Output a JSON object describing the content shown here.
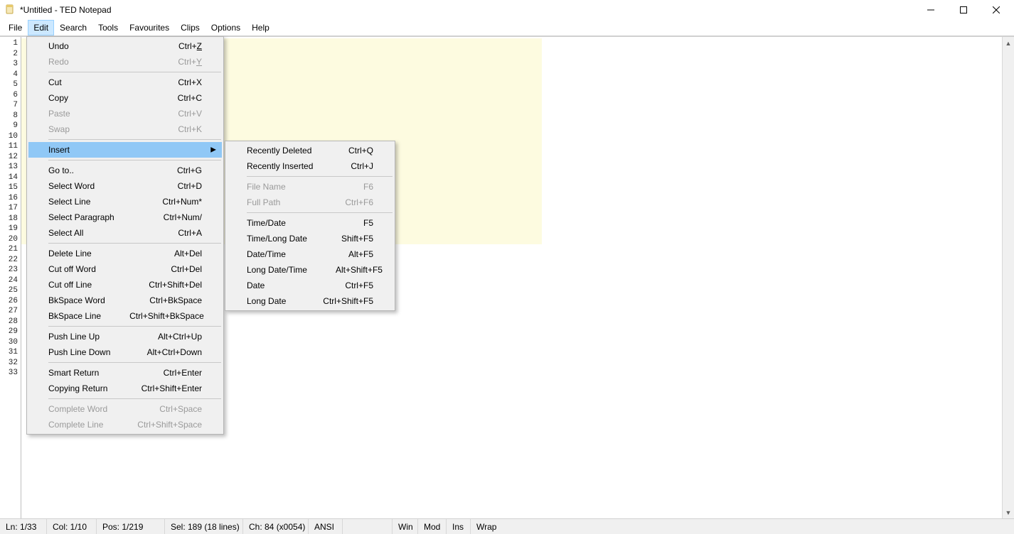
{
  "window": {
    "title": "*Untitled - TED Notepad"
  },
  "menubar": [
    "File",
    "Edit",
    "Search",
    "Tools",
    "Favourites",
    "Clips",
    "Options",
    "Help"
  ],
  "gutter_lines": 33,
  "edit_menu": {
    "groups": [
      [
        {
          "label": "Undo",
          "shortcut_prefix": "Ctrl+",
          "shortcut_ul": "Z",
          "disabled": false
        },
        {
          "label": "Redo",
          "shortcut_prefix": "Ctrl+",
          "shortcut_ul": "Y",
          "disabled": true
        }
      ],
      [
        {
          "label": "Cut",
          "shortcut": "Ctrl+X"
        },
        {
          "label": "Copy",
          "shortcut": "Ctrl+C"
        },
        {
          "label": "Paste",
          "shortcut": "Ctrl+V",
          "disabled": true
        },
        {
          "label": "Swap",
          "shortcut": "Ctrl+K",
          "disabled": true
        }
      ],
      [
        {
          "label": "Insert",
          "submenu": true,
          "highlight": true
        }
      ],
      [
        {
          "label": "Go to..",
          "shortcut": "Ctrl+G"
        },
        {
          "label": "Select Word",
          "shortcut": "Ctrl+D"
        },
        {
          "label": "Select Line",
          "shortcut": "Ctrl+Num*"
        },
        {
          "label": "Select Paragraph",
          "shortcut": "Ctrl+Num/"
        },
        {
          "label": "Select All",
          "shortcut": "Ctrl+A"
        }
      ],
      [
        {
          "label": "Delete Line",
          "shortcut": "Alt+Del"
        },
        {
          "label": "Cut off Word",
          "shortcut": "Ctrl+Del"
        },
        {
          "label": "Cut off Line",
          "shortcut": "Ctrl+Shift+Del"
        },
        {
          "label": "BkSpace Word",
          "shortcut": "Ctrl+BkSpace"
        },
        {
          "label": "BkSpace Line",
          "shortcut": "Ctrl+Shift+BkSpace"
        }
      ],
      [
        {
          "label": "Push Line Up",
          "shortcut": "Alt+Ctrl+Up"
        },
        {
          "label": "Push Line Down",
          "shortcut": "Alt+Ctrl+Down"
        }
      ],
      [
        {
          "label": "Smart Return",
          "shortcut": "Ctrl+Enter"
        },
        {
          "label": "Copying Return",
          "shortcut": "Ctrl+Shift+Enter"
        }
      ],
      [
        {
          "label": "Complete Word",
          "shortcut": "Ctrl+Space",
          "disabled": true
        },
        {
          "label": "Complete Line",
          "shortcut": "Ctrl+Shift+Space",
          "disabled": true
        }
      ]
    ]
  },
  "insert_submenu": {
    "groups": [
      [
        {
          "label": "Recently Deleted",
          "shortcut": "Ctrl+Q"
        },
        {
          "label": "Recently Inserted",
          "shortcut": "Ctrl+J"
        }
      ],
      [
        {
          "label": "File Name",
          "shortcut": "F6",
          "disabled": true
        },
        {
          "label": "Full Path",
          "shortcut": "Ctrl+F6",
          "disabled": true
        }
      ],
      [
        {
          "label": "Time/Date",
          "shortcut": "F5"
        },
        {
          "label": "Time/Long Date",
          "shortcut": "Shift+F5"
        },
        {
          "label": "Date/Time",
          "shortcut": "Alt+F5"
        },
        {
          "label": "Long Date/Time",
          "shortcut": "Alt+Shift+F5"
        },
        {
          "label": "Date",
          "shortcut": "Ctrl+F5"
        },
        {
          "label": "Long Date",
          "shortcut": "Ctrl+Shift+F5"
        }
      ]
    ]
  },
  "statusbar": {
    "ln": "Ln: 1/33",
    "col": "Col: 1/10",
    "pos": "Pos: 1/219",
    "sel": "Sel: 189 (18 lines)",
    "ch": "Ch: 84 (x0054)",
    "enc": "ANSI",
    "win": "Win",
    "mod": "Mod",
    "ins": "Ins",
    "wrap": "Wrap"
  }
}
